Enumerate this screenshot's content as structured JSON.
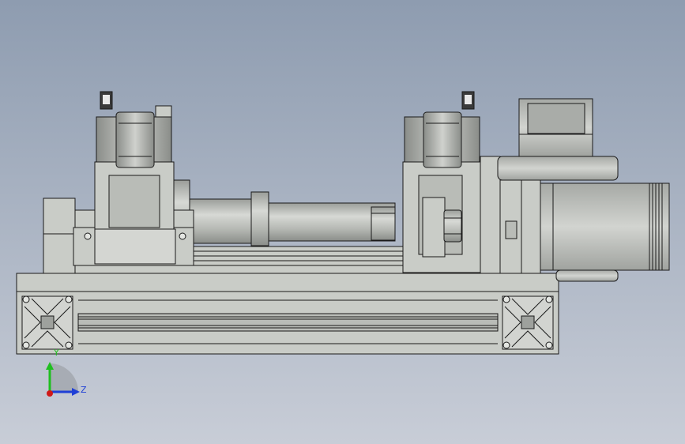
{
  "view": {
    "background_top": "#8f9db1",
    "background_bottom": "#c7ccd6",
    "part_color": "#c9ccc7",
    "edge_color": "#1a1a1a"
  },
  "triad": {
    "y_label": "Y",
    "z_label": "Z",
    "y_color": "#1fbf1f",
    "z_color": "#1f3fd6",
    "x_color": "#d01818"
  }
}
